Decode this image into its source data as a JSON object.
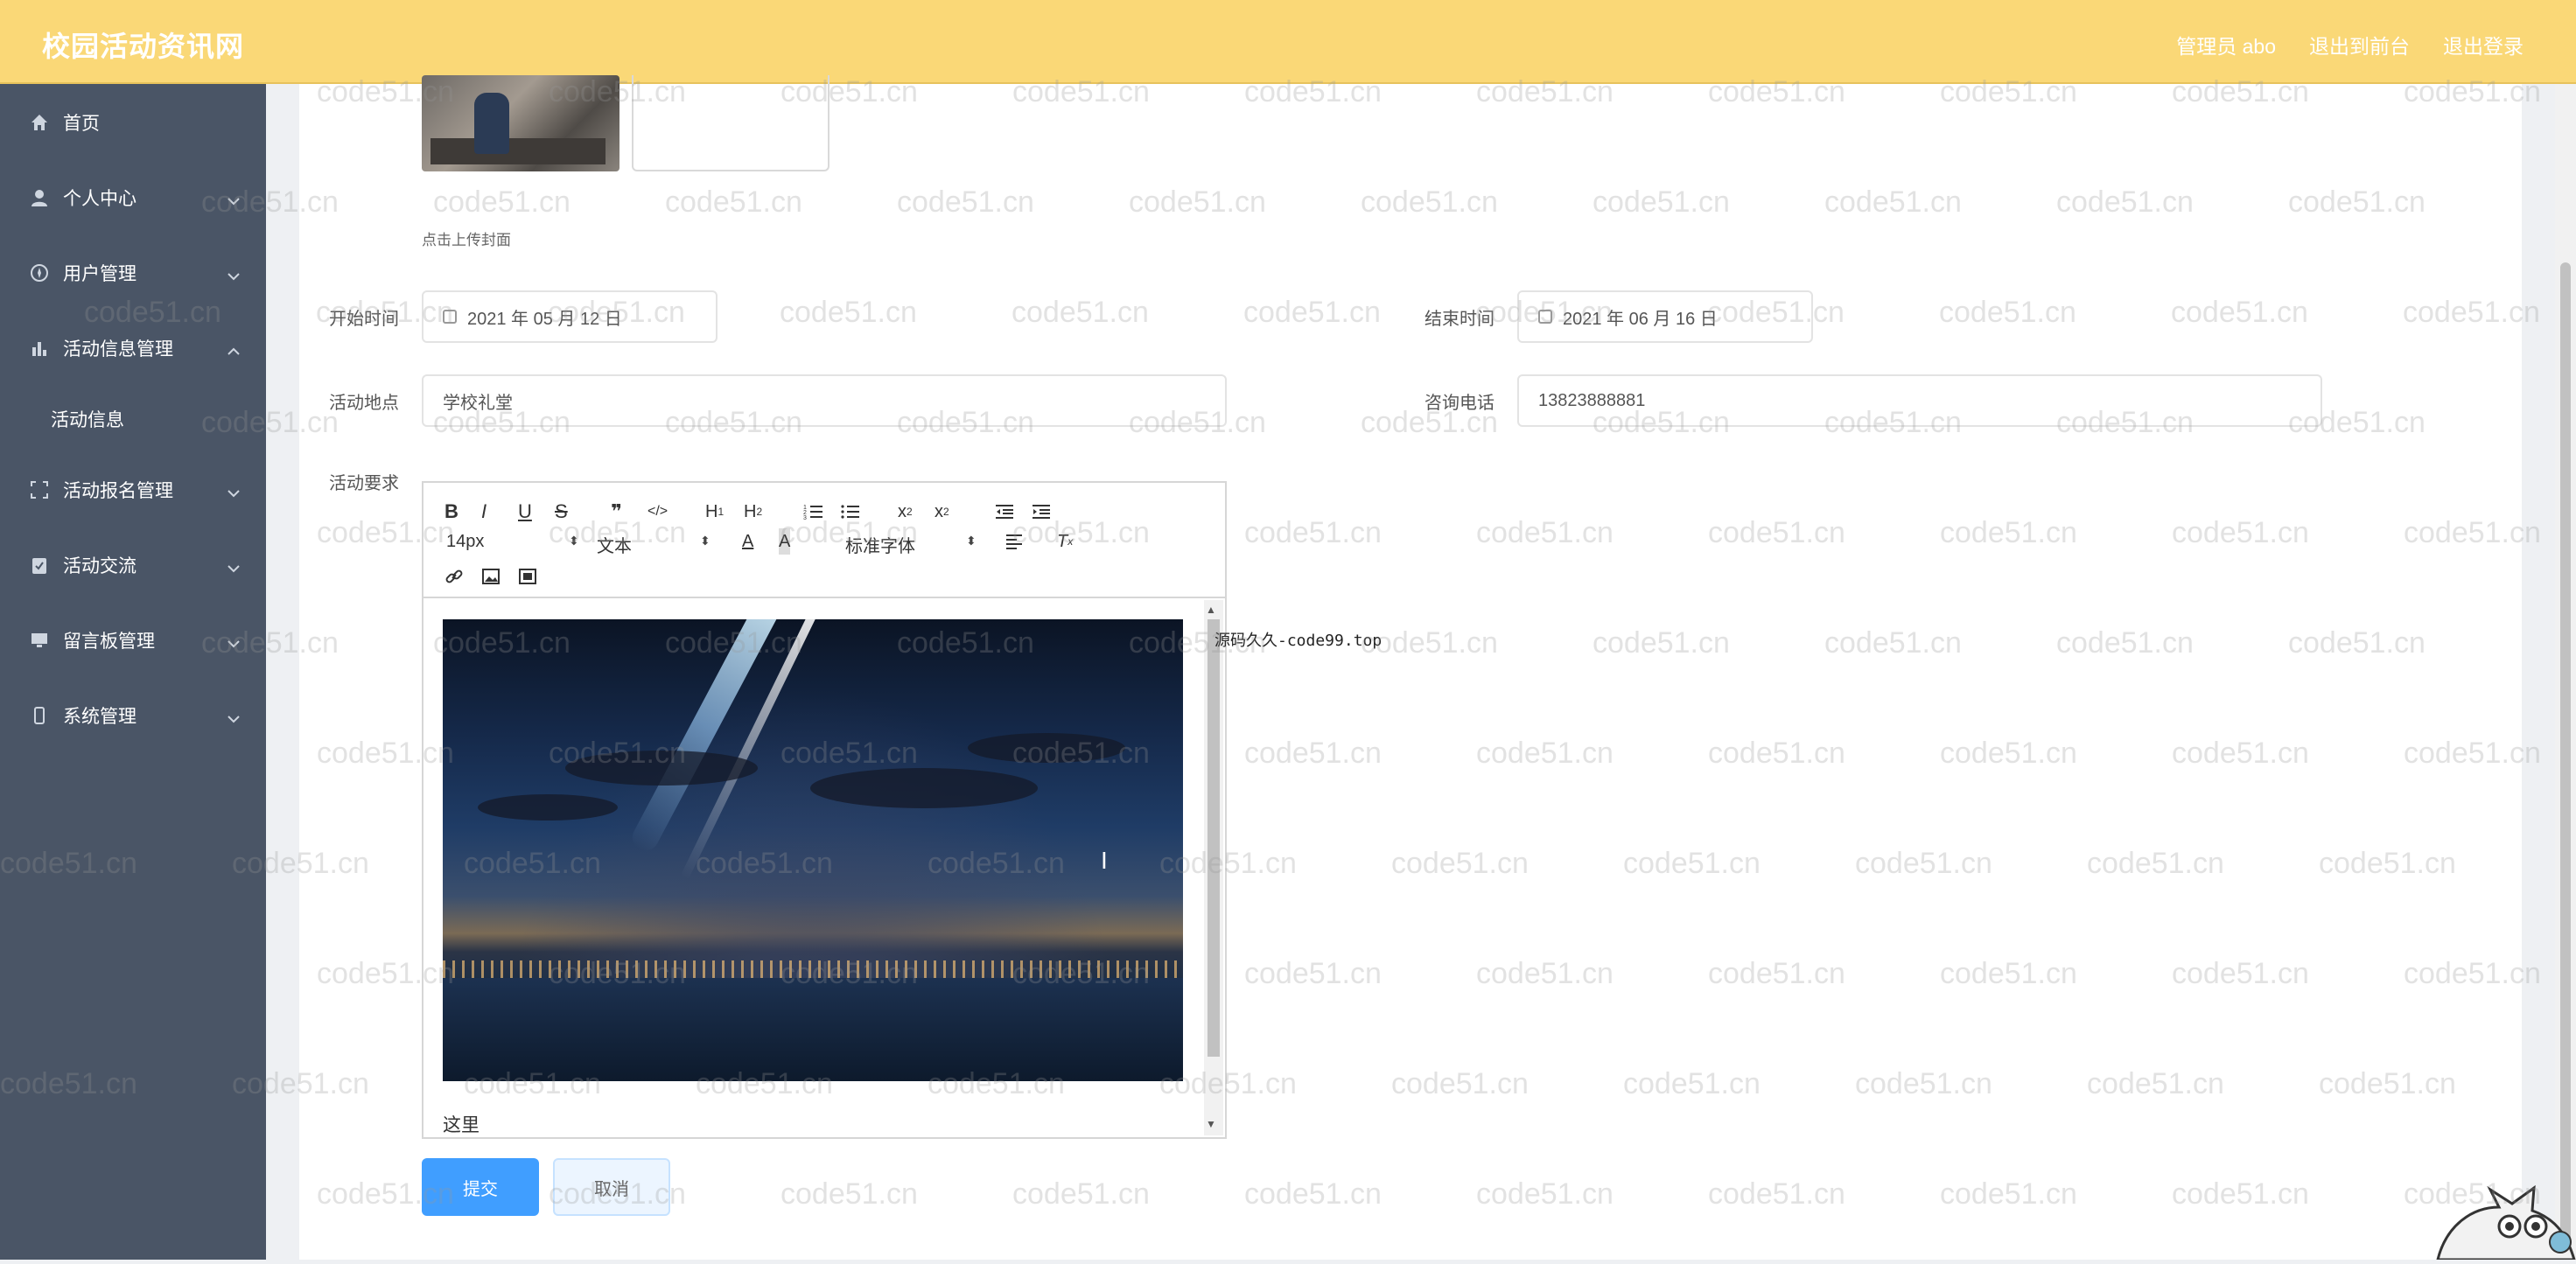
{
  "header": {
    "brand": "校园活动资讯网",
    "admin_label": "管理员 abo",
    "exit_console": "退出到前台",
    "logout": "退出登录"
  },
  "sidebar": {
    "items": [
      {
        "label": "首页",
        "icon": "home-icon"
      },
      {
        "label": "个人中心",
        "icon": "user-icon"
      },
      {
        "label": "用户管理",
        "icon": "compass-icon"
      },
      {
        "label": "活动信息管理",
        "icon": "chart-icon"
      },
      {
        "label": "活动报名管理",
        "icon": "scan-icon"
      },
      {
        "label": "活动交流",
        "icon": "clipboard-icon"
      },
      {
        "label": "留言板管理",
        "icon": "monitor-icon"
      },
      {
        "label": "系统管理",
        "icon": "phone-icon"
      }
    ],
    "sub_item": "活动信息"
  },
  "form": {
    "upload_hint": "点击上传封面",
    "start_label": "开始时间",
    "start_value": "2021 年 05 月 12 日",
    "end_label": "结束时间",
    "end_value": "2021 年 06 月 16 日",
    "location_label": "活动地点",
    "location_value": "学校礼堂",
    "phone_label": "咨询电话",
    "phone_value": "13823888881",
    "requirement_label": "活动要求"
  },
  "editor": {
    "font_size": "14px",
    "block_format": "文本",
    "font_family": "标准字体",
    "content_text": "这里",
    "side_text": "源码久久-code99.top"
  },
  "buttons": {
    "submit": "提交",
    "cancel": "取消"
  },
  "watermark": "code51.cn"
}
